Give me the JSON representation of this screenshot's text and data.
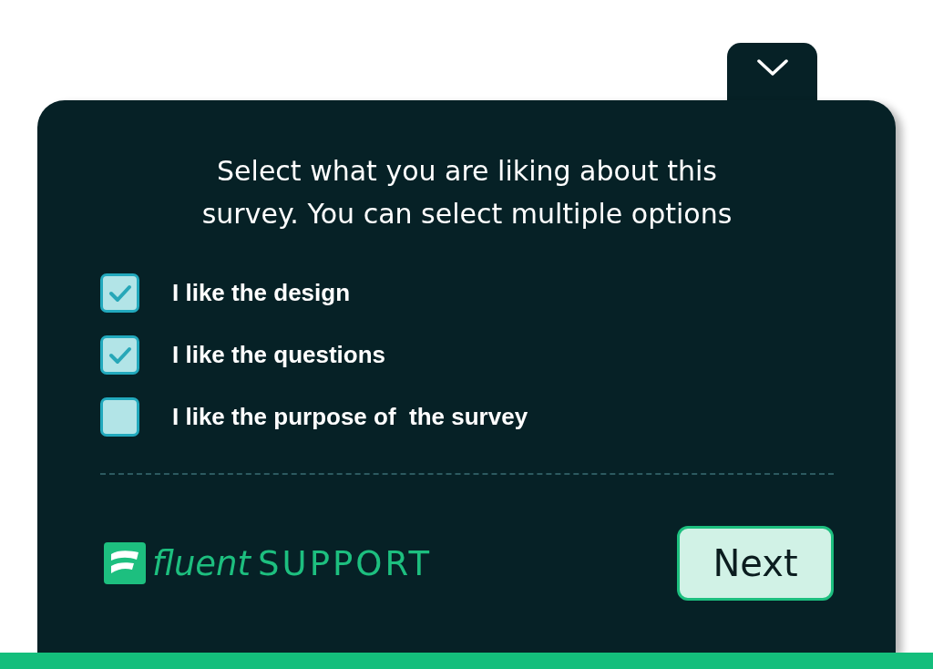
{
  "question": "Select what you are liking about this survey. You can select multiple options",
  "options": [
    {
      "label": "I like the design",
      "checked": true
    },
    {
      "label": "I like the questions",
      "checked": true
    },
    {
      "label": "I like the purpose of  the survey",
      "checked": false
    }
  ],
  "logo": {
    "script": "fluent",
    "caps": "SUPPORT"
  },
  "next_button": "Next"
}
